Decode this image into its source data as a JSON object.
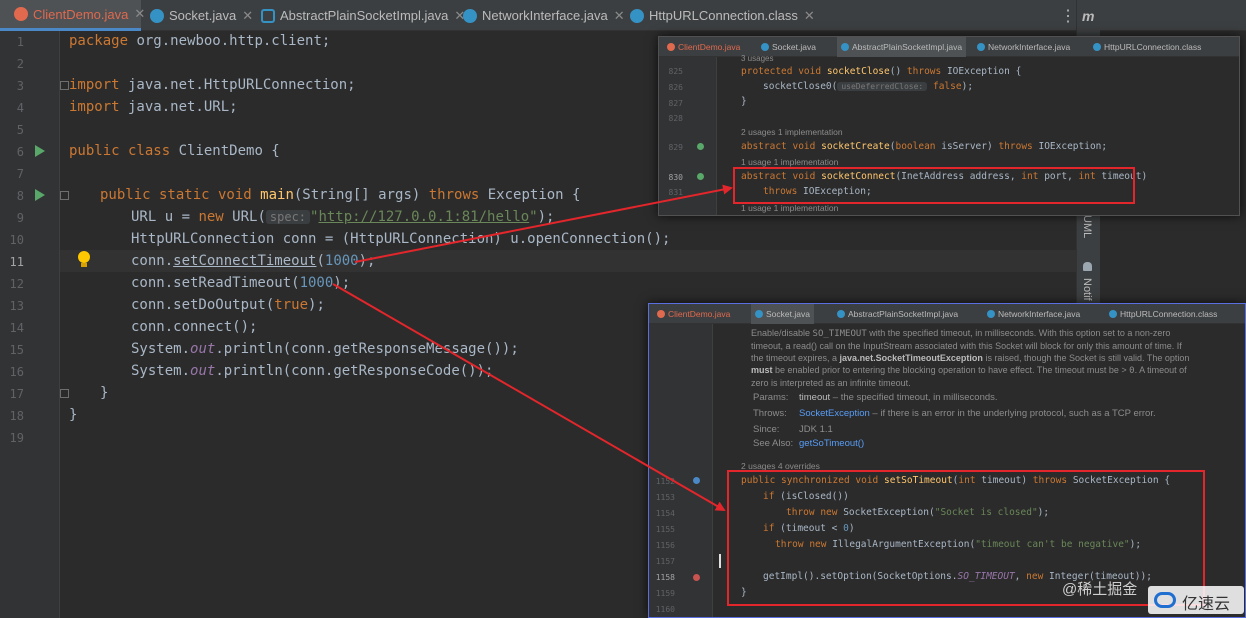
{
  "editor": {
    "tabs": [
      {
        "label": "ClientDemo.java",
        "icon": "class-icon",
        "active": true
      },
      {
        "label": "Socket.java",
        "icon": "class-icon"
      },
      {
        "label": "AbstractPlainSocketImpl.java",
        "icon": "abstract-class-icon"
      },
      {
        "label": "NetworkInterface.java",
        "icon": "class-icon"
      },
      {
        "label": "HttpURLConnection.class",
        "icon": "class-icon"
      }
    ],
    "close_glyph": "✕",
    "menu_glyph": "⋮",
    "right_strip": {
      "top": "m",
      "maven": "UML",
      "notify": "Notif"
    },
    "line_numbers": [
      "1",
      "2",
      "3",
      "4",
      "5",
      "6",
      "7",
      "8",
      "9",
      "10",
      "11",
      "12",
      "13",
      "14",
      "15",
      "16",
      "17",
      "18",
      "19"
    ],
    "current_line": "11",
    "code": {
      "l1_kw": "package",
      "l1_rest": " org.newboo.http.client;",
      "l3_kw": "import",
      "l3_rest": " java.net.HttpURLConnection;",
      "l4_kw": "import",
      "l4_rest": " java.net.URL;",
      "l6_kw": "public class",
      "l6_rest": " ClientDemo {",
      "l8_kw": "public static void",
      "l8_fn": "main",
      "l8_a": "(String[] args) ",
      "l8_kw2": "throws",
      "l8_b": " Exception {",
      "l9_a": "URL u = ",
      "l9_kw": "new",
      "l9_b": " URL(",
      "l9_hint": "spec:",
      "l9_str1": "\"",
      "l9_url": "http://127.0.0.1:81/hello",
      "l9_str2": "\"",
      "l9_c": ");",
      "l10": "HttpURLConnection conn = (HttpURLConnection) u.openConnection();",
      "l11_a": "conn.",
      "l11_m": "setConnectTimeout",
      "l11_b": "(",
      "l11_n": "1000",
      "l11_c": ");",
      "l12_a": "conn.setReadTimeout(",
      "l12_n": "1000",
      "l12_c": ");",
      "l13_a": "conn.setDoOutput(",
      "l13_kw": "true",
      "l13_c": ");",
      "l14": "conn.connect();",
      "l15_a": "System.",
      "l15_st": "out",
      "l15_b": ".println(conn.getResponseMessage());",
      "l16_a": "System.",
      "l16_st": "out",
      "l16_b": ".println(conn.getResponseCode());",
      "l17": "}",
      "l18": "}"
    }
  },
  "popup1": {
    "tabs": [
      "ClientDemo.java",
      "Socket.java",
      "AbstractPlainSocketImpl.java",
      "NetworkInterface.java",
      "HttpURLConnection.class"
    ],
    "line_numbers": [
      "825",
      "826",
      "827",
      "828",
      "829",
      "830",
      "831"
    ],
    "usages_top": "3 usages",
    "l825_kw": "protected void",
    "l825_fn": "socketClose",
    "l825_a": "() ",
    "l825_kw2": "throws",
    "l825_b": " IOException {",
    "l826_a": "socketClose0(",
    "l826_hint": "useDeferredClose:",
    "l826_kw": "false",
    "l826_b": ");",
    "l827": "}",
    "meta1": "2 usages   1 implementation",
    "l829_kw": "abstract void",
    "l829_fn": "socketCreate",
    "l829_a": "(",
    "l829_kw2": "boolean",
    "l829_b": " isServer) ",
    "l829_kw3": "throws",
    "l829_c": " IOException;",
    "meta2": "1 usage   1 implementation",
    "l830_kw": "abstract void",
    "l830_fn": "socketConnect",
    "l830_a": "(InetAddress address, ",
    "l830_kw2": "int",
    "l830_b": " port, ",
    "l830_kw3": "int",
    "l830_c": " timeout)",
    "l831_kw": "throws",
    "l831_rest": " IOException;",
    "meta3": "1 usage   1 implementation"
  },
  "popup2": {
    "tabs": [
      "ClientDemo.java",
      "Socket.java",
      "AbstractPlainSocketImpl.java",
      "NetworkInterface.java",
      "HttpURLConnection.class"
    ],
    "doc_intro_a": "Enable/disable ",
    "doc_intro_code": "SO_TIMEOUT",
    "doc_intro_b": " with the specified timeout, in milliseconds. With this option set to a non-zero timeout, a read() call on the InputStream associated with this Socket will block for only this amount of time. If the timeout expires, a ",
    "doc_intro_bold": "java.net.SocketTimeoutException",
    "doc_intro_c": " is raised, though the Socket is still valid. The option ",
    "doc_intro_must": "must",
    "doc_intro_d": " be enabled prior to entering the blocking operation to have effect. The timeout must be > ",
    "doc_intro_zero": "0",
    "doc_intro_e": ". A timeout of zero is interpreted as an infinite timeout.",
    "params_label": "Params:",
    "params_name": "timeout",
    "params_desc": " – the specified timeout, in milliseconds.",
    "throws_label": "Throws:",
    "throws_link": "SocketException",
    "throws_desc": " – if there is an error in the underlying protocol, such as a TCP error.",
    "since_label": "Since:",
    "since_value": "JDK 1.1",
    "seealso_label": "See Also:",
    "seealso_link": "getSoTimeout()",
    "meta": "2 usages   4 overrides",
    "line_numbers": [
      "1152",
      "1153",
      "1154",
      "1155",
      "1156",
      "1157",
      "1158",
      "1159",
      "1160"
    ],
    "l1152_kw": "public synchronized void",
    "l1152_fn": "setSoTimeout",
    "l1152_a": "(",
    "l1152_kw2": "int",
    "l1152_b": " timeout) ",
    "l1152_kw3": "throws",
    "l1152_c": " SocketException {",
    "l1153_kw": "if",
    "l1153_rest": " (isClosed())",
    "l1154_kw": "throw new",
    "l1154_a": " SocketException(",
    "l1154_s": "\"Socket is closed\"",
    "l1154_b": ");",
    "l1155_kw": "if",
    "l1155_a": " (timeout < ",
    "l1155_n": "0",
    "l1155_b": ")",
    "l1156_kw": "throw new",
    "l1156_a": " IllegalArgumentException(",
    "l1156_s": "\"timeout can't be negative\"",
    "l1156_b": ");",
    "l1158_a": "getImpl().setOption(SocketOptions.",
    "l1158_st": "SO_TIMEOUT",
    "l1158_b": ", ",
    "l1158_kw": "new",
    "l1158_c": " Integer(timeout));",
    "l1159": "}"
  },
  "watermarks": {
    "juejin": "@稀土掘金",
    "yisu": "亿速云"
  },
  "colors": {
    "annotation_red": "#e2262b",
    "active_tab": "#e0694e",
    "run_green": "#59a869",
    "keyword": "#cc7832",
    "string": "#6a8759",
    "number": "#6897bb",
    "method": "#ffc66d"
  }
}
